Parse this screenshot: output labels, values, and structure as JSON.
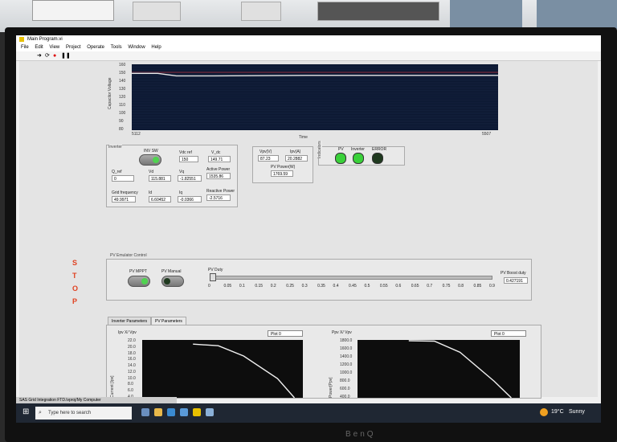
{
  "window": {
    "title": "Main Program.vi"
  },
  "menu": [
    "File",
    "Edit",
    "View",
    "Project",
    "Operate",
    "Tools",
    "Window",
    "Help"
  ],
  "toolbar": {
    "run_icon": "run-arrow-icon",
    "continuous_icon": "run-continuous-icon",
    "abort_icon": "abort-icon",
    "pause_icon": "pause-icon"
  },
  "top_chart": {
    "ylabel": "Capacitor Voltage",
    "yticks": [
      "160",
      "150",
      "140",
      "130",
      "120",
      "110",
      "100",
      "90",
      "80"
    ],
    "xlabel": "Time",
    "x_start": "5112",
    "x_end": "5507",
    "trace_color": "#e8e8e8",
    "line_color2": "#ff3030"
  },
  "chart_data": [
    {
      "type": "line",
      "ylabel": "Capacitor Voltage",
      "xlabel": "Time",
      "ylim": [
        80,
        160
      ],
      "xlim": [
        5112,
        5507
      ],
      "series": [
        {
          "values": [
            [
              5112,
              149
            ],
            [
              5140,
              149
            ],
            [
              5160,
              146
            ],
            [
              5200,
              146
            ],
            [
              5300,
              146.5
            ],
            [
              5400,
              146.5
            ],
            [
              5507,
              146.5
            ]
          ]
        }
      ]
    },
    {
      "type": "line",
      "ylabel": "Current [Ipv]",
      "title": "Ipv X/ Vpv",
      "ylim": [
        4,
        22
      ],
      "series": [
        {
          "name": "Plot 0",
          "values": [
            [
              0,
              20.7
            ],
            [
              0.3,
              20.2
            ],
            [
              0.6,
              17
            ],
            [
              1,
              10
            ],
            [
              1.2,
              4
            ]
          ]
        }
      ]
    },
    {
      "type": "line",
      "ylabel": "Power[Ppv]",
      "title": "Ppv X/ Vpv",
      "ylim": [
        400,
        1800
      ],
      "series": [
        {
          "name": "Plot 0",
          "values": [
            [
              0,
              1780
            ],
            [
              0.3,
              1770
            ],
            [
              0.6,
              1500
            ],
            [
              1,
              800
            ],
            [
              1.2,
              400
            ]
          ]
        }
      ]
    }
  ],
  "inverter": {
    "label": "Inverter",
    "inv_sw": "INV SW",
    "vdc_ref_label": "Vdc ref",
    "vdc_ref": "150",
    "v_dc_label": "V_dc",
    "v_dc": "149.71",
    "q_ref_label": "Q_ref",
    "q_ref": "0",
    "vd_label": "Vd",
    "vd": "115.881",
    "vq_label": "Vq",
    "vq": "-1.82551",
    "active_power_label": "Active Power",
    "active_power": "1535.86",
    "grid_freq_label": "Grid frequency",
    "grid_freq": "49.9971",
    "id_label": "Id",
    "id": "6.60452",
    "iq_label": "Iq",
    "iq": "-0.0366",
    "reactive_power_label": "Reactive Power",
    "reactive_power": "-2.5716"
  },
  "pv": {
    "vpv_label": "Vpv(V)",
    "vpv": "87.23",
    "ipv_label": "Ipv(A)",
    "ipv": "20.2882",
    "ppower_label": "PV Power(W)",
    "ppower": "1769.59"
  },
  "indicators": {
    "label": "Indicators",
    "items": [
      {
        "label": "PV",
        "color": "#3ad13a"
      },
      {
        "label": "Inverter",
        "color": "#3ad13a"
      },
      {
        "label": "ERROR",
        "color": "#1f3a1f"
      }
    ]
  },
  "stop": [
    "S",
    "T",
    "O",
    "P"
  ],
  "emulator": {
    "title": "PV Emulator Control",
    "mppt": "PV MPPT",
    "manual": "PV Manual",
    "duty_label": "PV Duty",
    "duty_ticks": [
      "0",
      "0.05",
      "0.1",
      "0.15",
      "0.2",
      "0.25",
      "0.3",
      "0.35",
      "0.4",
      "0.45",
      "0.5",
      "0.55",
      "0.6",
      "0.65",
      "0.7",
      "0.75",
      "0.8",
      "0.85",
      "0.9"
    ],
    "boost_label": "PV Boost duty",
    "boost": "0.427191"
  },
  "tabs": [
    "Inverter Parameters",
    "PV Parameters"
  ],
  "plot_left": {
    "title": "Ipv X/ Vpv",
    "legend": "Plot 0",
    "ylabel": "Current [Ipv]",
    "yticks": [
      "22.0",
      "20.0",
      "18.0",
      "16.0",
      "14.0",
      "12.0",
      "10.0",
      "8.0",
      "6.0",
      "4.0"
    ]
  },
  "plot_right": {
    "title": "Ppv X/ Vpv",
    "legend": "Plot 0",
    "ylabel": "Power[Ppv]",
    "yticks": [
      "1800.0",
      "1600.0",
      "1400.0",
      "1200.0",
      "1000.0",
      "800.0",
      "600.0",
      "400.0"
    ]
  },
  "statusbar": "SAS Grid Integration FTD.lvproj/My Computer",
  "taskbar": {
    "search": "Type here to search",
    "weather": "19°C",
    "weather_desc": "Sunny"
  },
  "brand": "BenQ"
}
